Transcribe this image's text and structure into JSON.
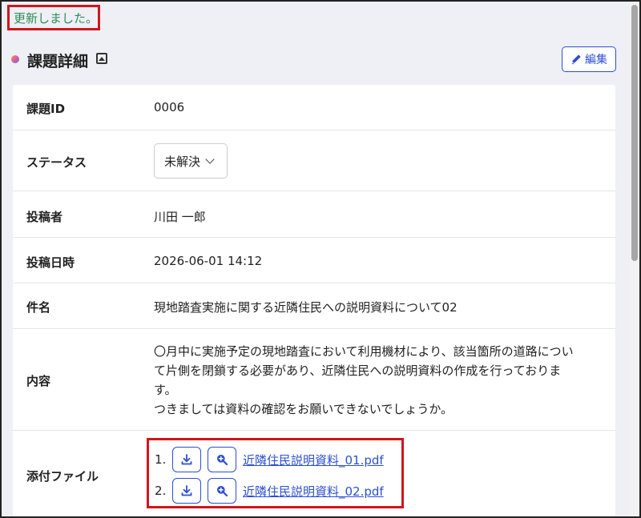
{
  "flash": {
    "message": "更新しました。"
  },
  "header": {
    "title": "課題詳細",
    "edit_label": "編集"
  },
  "fields": {
    "id": {
      "label": "課題ID",
      "value": "0006"
    },
    "status": {
      "label": "ステータス",
      "selected": "未解決"
    },
    "author": {
      "label": "投稿者",
      "value": "川田 一郎"
    },
    "posted_at": {
      "label": "投稿日時",
      "value": "2026-06-01 14:12"
    },
    "subject": {
      "label": "件名",
      "value": "現地踏査実施に関する近隣住民への説明資料について02"
    },
    "content": {
      "label": "内容",
      "lines": [
        "〇月中に実施予定の現地踏査において利用機材により、該当箇所の道路につい",
        "て片側を閉鎖する必要があり、近隣住民への説明資料の作成を行っておりま",
        "す。",
        "つきましては資料の確認をお願いできないでしょうか。"
      ]
    },
    "attachments": {
      "label": "添付ファイル",
      "files": [
        {
          "num": "1.",
          "name": "近隣住民説明資料_01.pdf"
        },
        {
          "num": "2.",
          "name": "近隣住民説明資料_02.pdf"
        }
      ]
    }
  },
  "colors": {
    "flash_text": "#2e8b57",
    "highlight_border": "#d0161b",
    "accent": "#2d4fd0",
    "page_bg": "#eef0f5"
  }
}
